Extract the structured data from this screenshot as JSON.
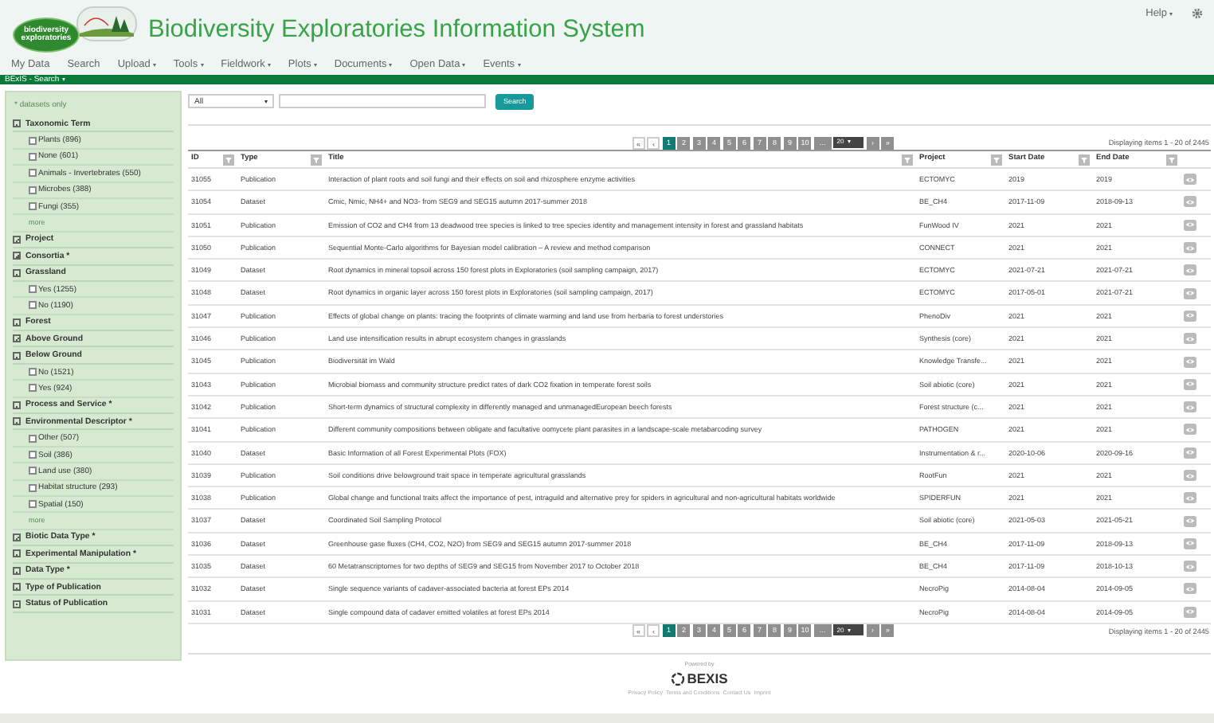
{
  "header": {
    "logo_lines": [
      "biodiversity",
      "exploratories"
    ],
    "title": "Biodiversity Exploratories Information System",
    "help": {
      "label": "Help",
      "dropdown": true
    }
  },
  "menu": [
    {
      "label": "My Data",
      "dropdown": false
    },
    {
      "label": "Search",
      "dropdown": false
    },
    {
      "label": "Upload",
      "dropdown": true
    },
    {
      "label": "Tools",
      "dropdown": true
    },
    {
      "label": "Fieldwork",
      "dropdown": true
    },
    {
      "label": "Plots",
      "dropdown": true
    },
    {
      "label": "Documents",
      "dropdown": true
    },
    {
      "label": "Open Data",
      "dropdown": true
    },
    {
      "label": "Events",
      "dropdown": true
    }
  ],
  "breadcrumb": {
    "label": "BExIS - Search",
    "dropdown": true
  },
  "sidebar": {
    "note": "* datasets only",
    "facets": [
      {
        "label": "Taxonomic Term",
        "expanded": true,
        "items": [
          {
            "label": "Plants (896)",
            "checked": false
          },
          {
            "label": "None (601)",
            "checked": false
          },
          {
            "label": "Animals - Invertebrates (550)",
            "checked": false
          },
          {
            "label": "Microbes (388)",
            "checked": false
          },
          {
            "label": "Fungi (355)",
            "checked": false
          }
        ],
        "more": "more"
      },
      {
        "label": "Project",
        "expanded": false
      },
      {
        "label": "Consortia *",
        "expanded": false
      },
      {
        "label": "Grassland",
        "expanded": true,
        "items": [
          {
            "label": "Yes (1255)",
            "checked": false
          },
          {
            "label": "No (1190)",
            "checked": false
          }
        ]
      },
      {
        "label": "Forest",
        "expanded": true
      },
      {
        "label": "Above Ground",
        "expanded": false
      },
      {
        "label": "Below Ground",
        "expanded": true,
        "items": [
          {
            "label": "No (1521)",
            "checked": false
          },
          {
            "label": "Yes (924)",
            "checked": false
          }
        ]
      },
      {
        "label": "Process and Service *",
        "expanded": true
      },
      {
        "label": "Environmental Descriptor *",
        "expanded": true,
        "items": [
          {
            "label": "Other (507)",
            "checked": false
          },
          {
            "label": "Soil (386)",
            "checked": false
          },
          {
            "label": "Land use (380)",
            "checked": false
          },
          {
            "label": "Habitat structure (293)",
            "checked": false
          },
          {
            "label": "Spatial (150)",
            "checked": false
          }
        ],
        "more": "more"
      },
      {
        "label": "Biotic Data Type *",
        "expanded": false
      },
      {
        "label": "Experimental Manipulation *",
        "expanded": true
      },
      {
        "label": "Data Type *",
        "expanded": true
      },
      {
        "label": "Type of Publication",
        "expanded": true
      },
      {
        "label": "Status of Publication",
        "expanded": true
      }
    ]
  },
  "search": {
    "scope": "All",
    "button": "Search"
  },
  "pagers": [
    {
      "first": "«",
      "prev": "‹",
      "pages": [
        {
          "label": "1",
          "selected": true
        },
        {
          "label": "2",
          "selected": false
        },
        {
          "label": "3",
          "selected": false
        },
        {
          "label": "4",
          "selected": false
        },
        {
          "label": "5",
          "selected": false
        },
        {
          "label": "6",
          "selected": false
        },
        {
          "label": "7",
          "selected": false
        },
        {
          "label": "8",
          "selected": false
        },
        {
          "label": "9",
          "selected": false
        },
        {
          "label": "10",
          "selected": false
        }
      ],
      "ellipsis": "...",
      "page_size": "20",
      "next": "›",
      "last": "»",
      "summary": "Displaying items 1 - 20 of 2445"
    },
    {
      "first": "«",
      "prev": "‹",
      "pages": [
        {
          "label": "1",
          "selected": true
        },
        {
          "label": "2",
          "selected": false
        },
        {
          "label": "3",
          "selected": false
        },
        {
          "label": "4",
          "selected": false
        },
        {
          "label": "5",
          "selected": false
        },
        {
          "label": "6",
          "selected": false
        },
        {
          "label": "7",
          "selected": false
        },
        {
          "label": "8",
          "selected": false
        },
        {
          "label": "9",
          "selected": false
        },
        {
          "label": "10",
          "selected": false
        }
      ],
      "ellipsis": "...",
      "page_size": "20",
      "next": "›",
      "last": "»",
      "summary": "Displaying items 1 - 20 of 2445"
    }
  ],
  "table": {
    "columns": [
      {
        "label": "ID",
        "filter": true
      },
      {
        "label": "Type",
        "filter": true
      },
      {
        "label": "Title",
        "filter": true
      },
      {
        "label": "Project",
        "filter": true
      },
      {
        "label": "Start Date",
        "filter": true
      },
      {
        "label": "End Date",
        "filter": true
      }
    ],
    "rows": [
      [
        "31055",
        "Publication",
        "Interaction of plant roots and soil fungi and their effects on soil and rhizosphere enzyme activities",
        "ECTOMYC",
        "2019",
        "2019"
      ],
      [
        "31054",
        "Dataset",
        "Cmic, Nmic, NH4+ and NO3- from SEG9 and SEG15 autumn 2017-summer 2018",
        "BE_CH4",
        "2017-11-09",
        "2018-09-13"
      ],
      [
        "31051",
        "Publication",
        "Emission of CO2 and CH4 from 13 deadwood tree species is linked to tree species identity and management intensity in forest and grassland habitats",
        "FunWood IV",
        "2021",
        "2021"
      ],
      [
        "31050",
        "Publication",
        "Sequential Monte-Carlo algorithms for Bayesian model calibration – A review and method comparison",
        "CONNECT",
        "2021",
        "2021"
      ],
      [
        "31049",
        "Dataset",
        "Root dynamics in mineral topsoil across 150 forest plots in Exploratories (soil sampling campaign, 2017)",
        "ECTOMYC",
        "2021-07-21",
        "2021-07-21"
      ],
      [
        "31048",
        "Dataset",
        "Root dynamics in organic layer across 150 forest plots in Exploratories (soil sampling campaign, 2017)",
        "ECTOMYC",
        "2017-05-01",
        "2021-07-21"
      ],
      [
        "31047",
        "Publication",
        "Effects of global change on plants: tracing the footprints of climate warming and land use from herbaria to forest understories",
        "PhenoDiv",
        "2021",
        "2021"
      ],
      [
        "31046",
        "Publication",
        "Land use intensification results in abrupt ecosystem changes in grasslands",
        "Synthesis (core)",
        "2021",
        "2021"
      ],
      [
        "31045",
        "Publication",
        "Biodiversität im Wald",
        "Knowledge Transfe...",
        "2021",
        "2021"
      ],
      [
        "31043",
        "Publication",
        "Microbial biomass and community structure predict rates of dark CO2 fixation in temperate forest soils",
        "Soil abiotic (core)",
        "2021",
        "2021"
      ],
      [
        "31042",
        "Publication",
        "Short-term dynamics of structural complexity in differently managed and unmanagedEuropean beech forests",
        "Forest structure (c...",
        "2021",
        "2021"
      ],
      [
        "31041",
        "Publication",
        "Different community compositions between obligate and facultative oomycete plant parasites in a landscape-scale metabarcoding survey",
        "PATHOGEN",
        "2021",
        "2021"
      ],
      [
        "31040",
        "Dataset",
        "Basic Information of all Forest Experimental Plots (FOX)",
        "Instrumentation & r...",
        "2020-10-06",
        "2020-09-16"
      ],
      [
        "31039",
        "Publication",
        "Soil conditions drive belowground trait space in temperate agricultural grasslands",
        "RootFun",
        "2021",
        "2021"
      ],
      [
        "31038",
        "Publication",
        "Global change and functional traits affect the importance of pest, intraguild and alternative prey for spiders in agricultural and non-agricultural habitats worldwide",
        "SPIDERFUN",
        "2021",
        "2021"
      ],
      [
        "31037",
        "Dataset",
        "Coordinated Soil Sampling Protocol",
        "Soil abiotic (core)",
        "2021-05-03",
        "2021-05-21"
      ],
      [
        "31036",
        "Dataset",
        "Greenhouse gase fluxes (CH4, CO2, N2O) from SEG9 and SEG15 autumn 2017-summer 2018",
        "BE_CH4",
        "2017-11-09",
        "2018-09-13"
      ],
      [
        "31035",
        "Dataset",
        "60 Metatranscriptomes for two depths of SEG9 and SEG15 from November 2017 to October 2018",
        "BE_CH4",
        "2017-11-09",
        "2018-10-13"
      ],
      [
        "31032",
        "Dataset",
        "Single sequence variants of cadaver-associated bacteria at forest EPs 2014",
        "NecroPig",
        "2014-08-04",
        "2014-09-05"
      ],
      [
        "31031",
        "Dataset",
        "Single compound data of cadaver emitted volatiles at forest EPs 2014",
        "NecroPig",
        "2014-08-04",
        "2014-09-05"
      ]
    ]
  },
  "footer": {
    "powered_by": "Powered by",
    "brand": "BEXIS",
    "links": [
      "Privacy Policy",
      "Terms and Conditions",
      "Contact Us",
      "Imprint"
    ]
  }
}
